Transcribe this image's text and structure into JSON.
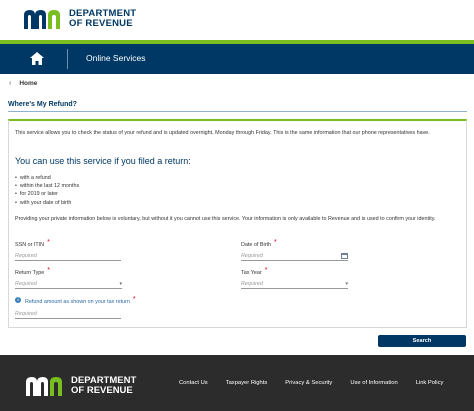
{
  "header": {
    "logo_line1": "DEPARTMENT",
    "logo_line2": "OF REVENUE"
  },
  "nav": {
    "home_icon": "home-icon",
    "title": "Online Services"
  },
  "breadcrumb": {
    "chevron": "‹",
    "home": "Home"
  },
  "page": {
    "title": "Where's My Refund?",
    "intro": "This service allows you to check the status of your refund and is updated overnight, Monday through Friday. This is the same information that our phone representatives have.",
    "heading": "You can use this service if you filed a return:",
    "conditions": [
      "with a refund",
      "within the last 12 months",
      "for 2019 or later",
      "with your date of birth"
    ],
    "privacy": "Providing your private information below is voluntary, but without it you cannot use this service. Your information is only available to Revenue and is used to confirm your identity."
  },
  "form": {
    "ssn_label": "SSN or ITIN",
    "ssn_placeholder": "Required",
    "dob_label": "Date of Birth",
    "dob_placeholder": "Required",
    "return_type_label": "Return Type",
    "return_type_placeholder": "Required",
    "tax_year_label": "Tax Year",
    "tax_year_placeholder": "Required",
    "refund_label": "Refund amount as shown on your tax return",
    "refund_placeholder": "Required",
    "required_marker": "*",
    "info_icon": "i",
    "search_button": "Search"
  },
  "footer": {
    "logo_line1": "DEPARTMENT",
    "logo_line2": "OF REVENUE",
    "links": [
      "Contact Us",
      "Taxpayer Rights",
      "Privacy & Security",
      "Use of Information",
      "Link Policy"
    ]
  },
  "colors": {
    "brand_blue": "#003865",
    "brand_green": "#78be21",
    "required_red": "#d0021b",
    "footer_bg": "#2c2c2c"
  }
}
